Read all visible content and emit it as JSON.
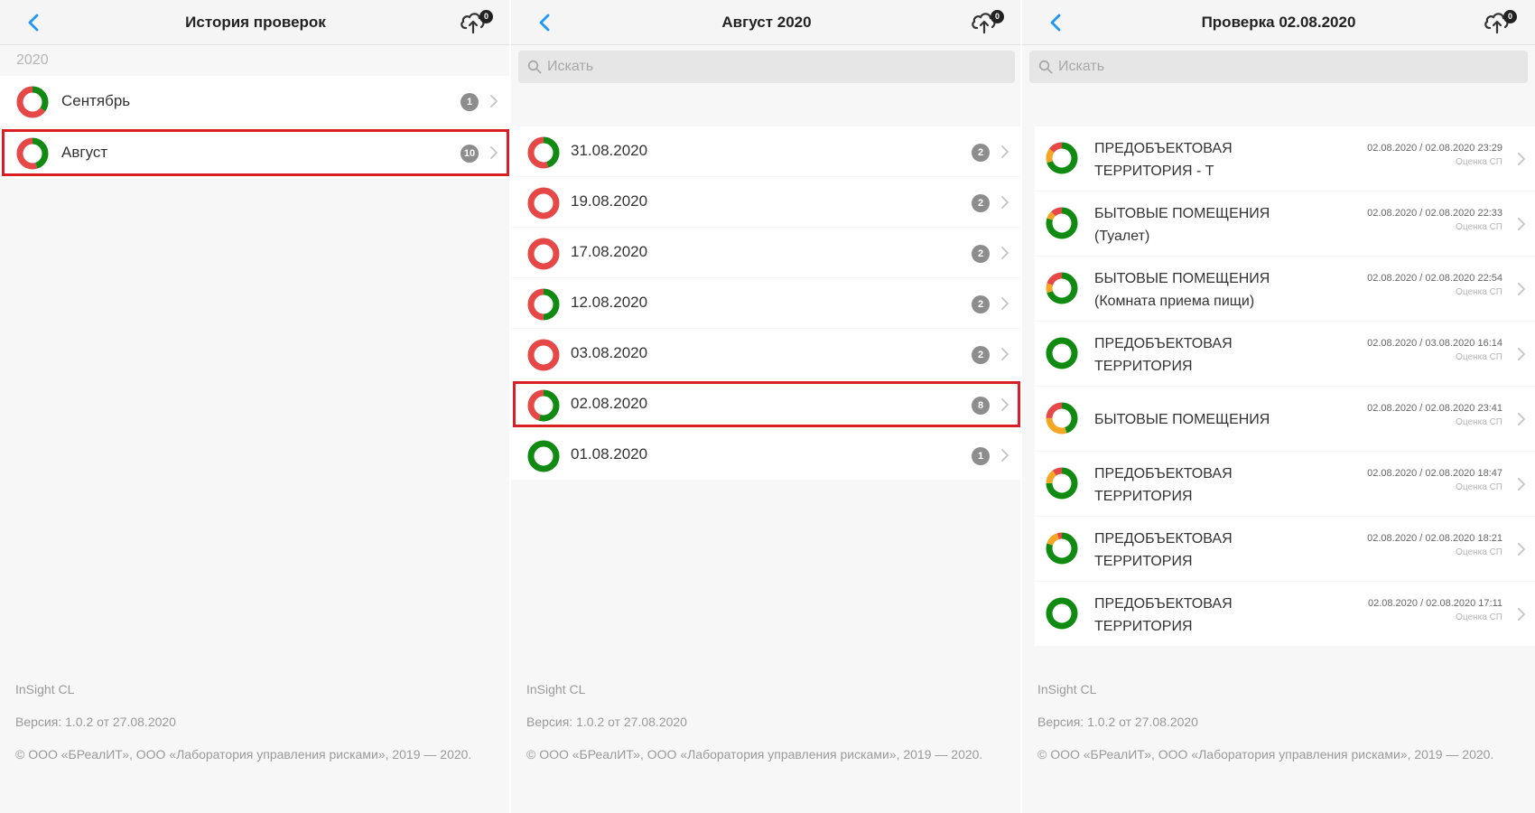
{
  "colors": {
    "accent": "#2196f3",
    "green": "#108a10",
    "red": "#e64848",
    "orange": "#f5a623",
    "highlight": "#d81f26",
    "badge": "#8d8d8d"
  },
  "panel1": {
    "title": "История проверок",
    "sync_badge": "0",
    "year": "2020",
    "months": [
      {
        "label": "Сентябрь",
        "count": "1",
        "green": 0.35,
        "red": 0.65,
        "orange": 0,
        "highlighted": false
      },
      {
        "label": "Август",
        "count": "10",
        "green": 0.45,
        "red": 0.55,
        "orange": 0,
        "highlighted": true
      }
    ]
  },
  "panel2": {
    "title": "Август 2020",
    "sync_badge": "0",
    "search_placeholder": "Искать",
    "dates": [
      {
        "label": "31.08.2020",
        "count": "2",
        "green": 0.45,
        "red": 0.55,
        "orange": 0,
        "highlighted": false
      },
      {
        "label": "19.08.2020",
        "count": "2",
        "green": 0,
        "red": 1,
        "orange": 0,
        "highlighted": false
      },
      {
        "label": "17.08.2020",
        "count": "2",
        "green": 0,
        "red": 1,
        "orange": 0,
        "highlighted": false
      },
      {
        "label": "12.08.2020",
        "count": "2",
        "green": 0.5,
        "red": 0.5,
        "orange": 0,
        "highlighted": false
      },
      {
        "label": "03.08.2020",
        "count": "2",
        "green": 0,
        "red": 1,
        "orange": 0,
        "highlighted": false
      },
      {
        "label": "02.08.2020",
        "count": "8",
        "green": 0.55,
        "red": 0.45,
        "orange": 0,
        "highlighted": true
      },
      {
        "label": "01.08.2020",
        "count": "1",
        "green": 1,
        "red": 0,
        "orange": 0,
        "highlighted": false
      }
    ]
  },
  "panel3": {
    "title": "Проверка 02.08.2020",
    "sync_badge": "0",
    "search_placeholder": "Искать",
    "checks": [
      {
        "line1": "ПРЕДОБЪЕКТОВАЯ",
        "line2": "ТЕРРИТОРИЯ - Т",
        "dates": "02.08.2020 / 02.08.2020 23:29",
        "sub": "Оценка СП",
        "green": 0.7,
        "red": 0.15,
        "orange": 0.15
      },
      {
        "line1": "БЫТОВЫЕ ПОМЕЩЕНИЯ",
        "line2": "(Туалет)",
        "dates": "02.08.2020 / 02.08.2020 22:33",
        "sub": "Оценка СП",
        "green": 0.8,
        "red": 0.12,
        "orange": 0.08
      },
      {
        "line1": "БЫТОВЫЕ ПОМЕЩЕНИЯ",
        "line2": "(Комната приема пищи)",
        "dates": "02.08.2020 / 02.08.2020 22:54",
        "sub": "Оценка СП",
        "green": 0.7,
        "red": 0.2,
        "orange": 0.1
      },
      {
        "line1": "ПРЕДОБЪЕКТОВАЯ",
        "line2": "ТЕРРИТОРИЯ",
        "dates": "02.08.2020 / 03.08.2020 16:14",
        "sub": "Оценка СП",
        "green": 1,
        "red": 0,
        "orange": 0
      },
      {
        "line1": "БЫТОВЫЕ ПОМЕЩЕНИЯ",
        "line2": "",
        "dates": "02.08.2020 / 02.08.2020 23:41",
        "sub": "Оценка СП",
        "green": 0.45,
        "red": 0.25,
        "orange": 0.3
      },
      {
        "line1": "ПРЕДОБЪЕКТОВАЯ",
        "line2": "ТЕРРИТОРИЯ",
        "dates": "02.08.2020 / 02.08.2020 18:47",
        "sub": "Оценка СП",
        "green": 0.75,
        "red": 0.1,
        "orange": 0.15
      },
      {
        "line1": "ПРЕДОБЪЕКТОВАЯ",
        "line2": "ТЕРРИТОРИЯ",
        "dates": "02.08.2020 / 02.08.2020 18:21",
        "sub": "Оценка СП",
        "green": 0.8,
        "red": 0.05,
        "orange": 0.15
      },
      {
        "line1": "ПРЕДОБЪЕКТОВАЯ",
        "line2": "ТЕРРИТОРИЯ",
        "dates": "02.08.2020 / 02.08.2020 17:11",
        "sub": "Оценка СП",
        "green": 1,
        "red": 0,
        "orange": 0
      }
    ]
  },
  "footer": {
    "app_name": "InSight CL",
    "version": "Версия: 1.0.2 от 27.08.2020",
    "copyright": "© ООО «БРеалИТ», ООО «Лаборатория управления рисками», 2019 — 2020."
  }
}
